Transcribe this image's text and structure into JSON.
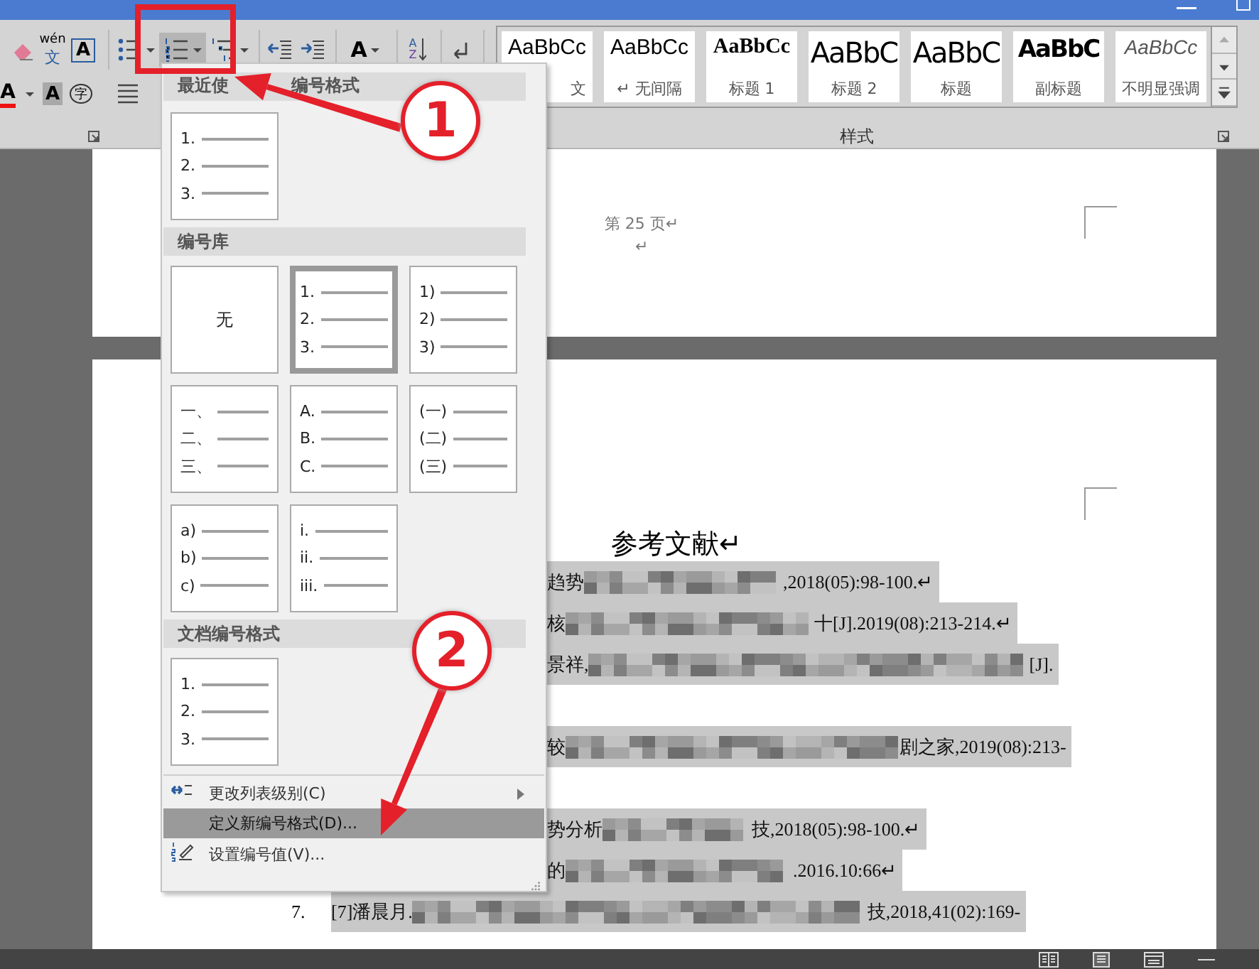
{
  "ribbon": {
    "font_buttons": [
      {
        "kind": "clear-format"
      },
      {
        "kind": "phonetic-guide",
        "letters": [
          "wén",
          "文"
        ]
      },
      {
        "kind": "character-border",
        "letters": [
          "A"
        ]
      },
      {
        "kind": "font-color",
        "letters": [
          "A"
        ]
      },
      {
        "kind": "character-shading",
        "letters": [
          "A"
        ]
      },
      {
        "kind": "enclose-characters",
        "letters": [
          "字"
        ]
      }
    ],
    "paragraph_buttons": [
      {
        "kind": "bullets",
        "open": false
      },
      {
        "kind": "numbering",
        "open": true
      },
      {
        "kind": "multilevel",
        "open": false
      },
      {
        "kind": "decrease-indent",
        "open": false
      },
      {
        "kind": "increase-indent",
        "open": false
      },
      {
        "kind": "asian-layout",
        "open": false,
        "letters": [
          "A"
        ]
      },
      {
        "kind": "sort",
        "open": false,
        "letters": [
          "A",
          "Z"
        ]
      },
      {
        "kind": "show-marks",
        "open": false
      },
      {
        "kind": "align-left",
        "open": false
      }
    ],
    "styles": {
      "title": "样式",
      "items": [
        {
          "kind": "body",
          "sample": "AaBbCc",
          "name": "文"
        },
        {
          "kind": "no-spacing",
          "sample": "AaBbCc",
          "name": "↵ 无间隔"
        },
        {
          "kind": "heading-1",
          "sample": "AaBbCc",
          "name": "标题 1"
        },
        {
          "kind": "heading-2",
          "sample": "AaBbC",
          "name": "标题 2"
        },
        {
          "kind": "title",
          "sample": "AaBbC",
          "name": "标题"
        },
        {
          "kind": "subtitle",
          "sample": "AaBbC",
          "name": "副标题"
        },
        {
          "kind": "subtle-emphasis",
          "sample": "AaBbCc",
          "name": "不明显强调"
        }
      ]
    }
  },
  "document": {
    "pages": [
      {
        "kind": "page-end",
        "footer": "第 25 页↵",
        "mark": "↵"
      },
      {
        "kind": "references",
        "heading": "参考文献↵",
        "references": [
          {
            "selected": true,
            "continued": false,
            "parts": [
              {
                "kind": "text",
                "text": "趋势"
              },
              {
                "kind": "redacted"
              },
              {
                "kind": "text",
                "text": ",2018(05):98-100.↵"
              }
            ]
          },
          {
            "selected": true,
            "continued": false,
            "parts": [
              {
                "kind": "text",
                "text": "核"
              },
              {
                "kind": "redacted"
              },
              {
                "kind": "text",
                "text": "十[J].2019(08):213-214.↵"
              }
            ]
          },
          {
            "selected": true,
            "continued": true,
            "parts": [
              {
                "kind": "text",
                "text": "景祥,"
              },
              {
                "kind": "redacted"
              },
              {
                "kind": "text",
                "text": "[J]."
              }
            ]
          },
          {
            "selected": true,
            "continued": true,
            "parts": [
              {
                "kind": "text",
                "text": "较"
              },
              {
                "kind": "redacted"
              },
              {
                "kind": "text",
                "text": "剧之家,2019(08):213-"
              }
            ]
          },
          {
            "selected": true,
            "continued": false,
            "parts": [
              {
                "kind": "text",
                "text": "势分析"
              },
              {
                "kind": "redacted"
              },
              {
                "kind": "text",
                "text": "技,2018(05):98-100.↵"
              }
            ]
          },
          {
            "selected": true,
            "continued": false,
            "parts": [
              {
                "kind": "text",
                "text": "的"
              },
              {
                "kind": "redacted"
              },
              {
                "kind": "text",
                "text": ".2016.10:66↵"
              }
            ]
          },
          {
            "selected": true,
            "continued": false,
            "number": "7.",
            "parts": [
              {
                "kind": "text",
                "text": "[7]潘晨月."
              },
              {
                "kind": "redacted"
              },
              {
                "kind": "text",
                "text": "技,2018,41(02):169-"
              }
            ]
          }
        ]
      }
    ]
  },
  "numbering_menu": {
    "sections": [
      {
        "title_parts": [
          "最近使",
          "编号格式"
        ],
        "formats": [
          {
            "kind": "list",
            "markers": [
              "1.",
              "2.",
              "3."
            ],
            "selected": false
          }
        ]
      },
      {
        "title": "编号库",
        "formats": [
          {
            "kind": "none",
            "label": "无",
            "selected": false
          },
          {
            "kind": "list",
            "markers": [
              "1.",
              "2.",
              "3."
            ],
            "selected": true
          },
          {
            "kind": "list",
            "markers": [
              "1)",
              "2)",
              "3)"
            ],
            "selected": false
          },
          {
            "kind": "list",
            "markers": [
              "一、",
              "二、",
              "三、"
            ],
            "selected": false
          },
          {
            "kind": "list",
            "markers": [
              "A.",
              "B.",
              "C."
            ],
            "selected": false
          },
          {
            "kind": "list",
            "markers": [
              "(一)",
              "(二)",
              "(三)"
            ],
            "selected": false
          },
          {
            "kind": "list",
            "markers": [
              "a)",
              "b)",
              "c)"
            ],
            "selected": false
          },
          {
            "kind": "list",
            "markers": [
              "i.",
              "ii.",
              "iii."
            ],
            "selected": false
          }
        ]
      },
      {
        "title": "文档编号格式",
        "formats": [
          {
            "kind": "list",
            "markers": [
              "1.",
              "2.",
              "3."
            ],
            "selected": false
          }
        ]
      }
    ],
    "commands": [
      {
        "kind": "change-level",
        "label": "更改列表级别(C)",
        "submenu": true,
        "highlighted": false
      },
      {
        "kind": "define-format",
        "label": "定义新编号格式(D)...",
        "submenu": false,
        "highlighted": true
      },
      {
        "kind": "set-value",
        "label": "设置编号值(V)...",
        "submenu": false,
        "highlighted": false
      }
    ]
  },
  "annotations": [
    {
      "label": "1"
    },
    {
      "label": "2"
    }
  ]
}
